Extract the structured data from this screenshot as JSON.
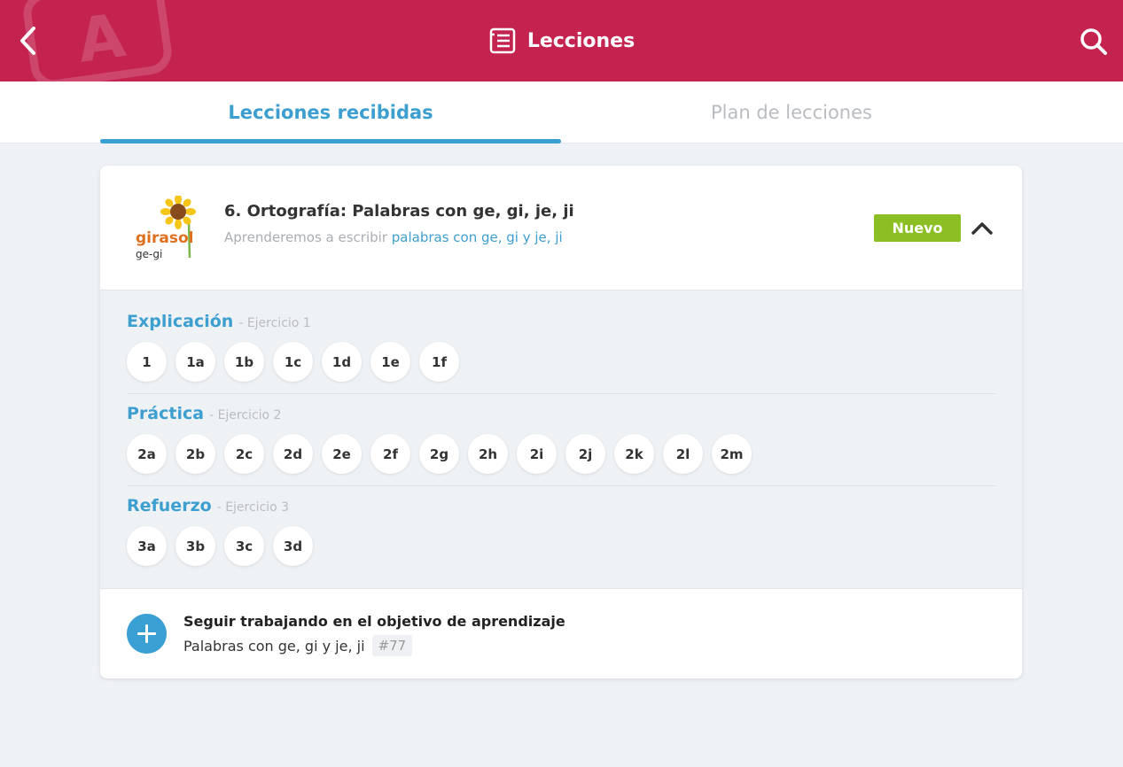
{
  "header": {
    "watermark_letter": "A",
    "title": "Lecciones",
    "back_icon": "chevron-left-icon",
    "title_icon": "list-icon",
    "search_icon": "search-icon"
  },
  "tabs": [
    {
      "label": "Lecciones recibidas",
      "active": true
    },
    {
      "label": "Plan de lecciones",
      "active": false
    }
  ],
  "lesson": {
    "logo_brand": "girasol",
    "logo_sub": "ge-gi",
    "title": "6. Ortografía: Palabras con ge, gi, je, ji",
    "subtitle_prefix": "Aprenderemos a escribir ",
    "subtitle_highlight": "palabras con ge, gi y je, ji",
    "badge": "Nuevo",
    "collapse_icon": "chevron-up-icon"
  },
  "sections": [
    {
      "name": "Explicación",
      "exercise": "- Ejercicio 1",
      "items": [
        "1",
        "1a",
        "1b",
        "1c",
        "1d",
        "1e",
        "1f"
      ]
    },
    {
      "name": "Práctica",
      "exercise": "- Ejercicio 2",
      "items": [
        "2a",
        "2b",
        "2c",
        "2d",
        "2e",
        "2f",
        "2g",
        "2h",
        "2i",
        "2j",
        "2k",
        "2l",
        "2m"
      ]
    },
    {
      "name": "Refuerzo",
      "exercise": "- Ejercicio 3",
      "items": [
        "3a",
        "3b",
        "3c",
        "3d"
      ]
    }
  ],
  "footer": {
    "title": "Seguir trabajando en el objetivo de aprendizaje",
    "subtitle": "Palabras con ge, gi y je, ji",
    "tag": "#77",
    "plus_icon": "plus-icon"
  },
  "colors": {
    "header": "#c42350",
    "accent": "#3a9fd3",
    "badge": "#8cbf24"
  }
}
